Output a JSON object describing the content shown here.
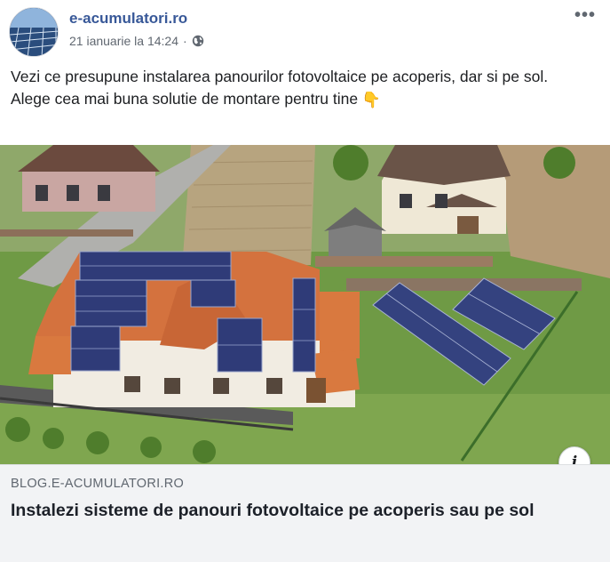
{
  "post": {
    "page_name": "e-acumulatori.ro",
    "timestamp": "21 ianuarie la 14:24",
    "separator": "·",
    "audience_icon": "globe-icon",
    "more_label": "•••",
    "text_line1": "Vezi ce presupune instalarea panourilor fotovoltaice pe acoperis, dar si pe sol.",
    "text_line2": "Alege cea mai buna solutie de montare pentru tine",
    "emoji": "👇"
  },
  "link_preview": {
    "domain": "BLOG.E-ACUMULATORI.RO",
    "title": "Instalezi sisteme de panouri fotovoltaice pe acoperis sau pe sol",
    "info_label": "i"
  },
  "colors": {
    "page_name": "#385898",
    "meta": "#606770",
    "preview_bg": "#f2f3f5"
  }
}
